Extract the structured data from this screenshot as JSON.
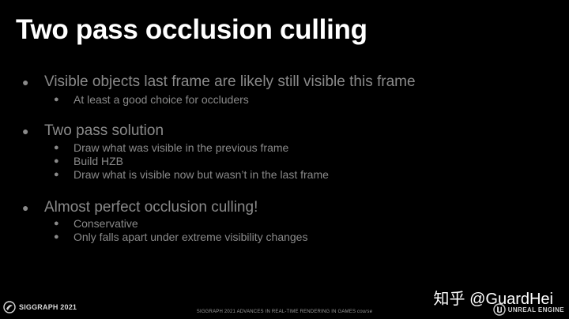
{
  "title": "Two pass occlusion culling",
  "bullets": [
    {
      "text": "Visible objects last frame are likely still visible this frame",
      "subs": [
        "At least a good choice for occluders"
      ]
    },
    {
      "text": "Two pass solution",
      "subs": [
        "Draw what was visible in the previous frame",
        "Build HZB",
        "Draw what is visible now but wasn’t in the last frame"
      ]
    },
    {
      "text": "Almost perfect occlusion culling!",
      "subs": [
        "Conservative",
        "Only falls apart under extreme visibility changes"
      ]
    }
  ],
  "bullet_symbol": "●",
  "footer": {
    "left_logo_text": "SIGGRAPH 2021",
    "center_text": "SIGGRAPH 2021 ADVANCES IN REAL-TIME RENDERING IN GAMES",
    "center_course": "course",
    "watermark": "知乎 @GuardHei",
    "right_logo_text": "UNREAL ENGINE"
  },
  "colors": {
    "background": "#000000",
    "title": "#ffffff",
    "body_text": "#8a8a8a"
  }
}
